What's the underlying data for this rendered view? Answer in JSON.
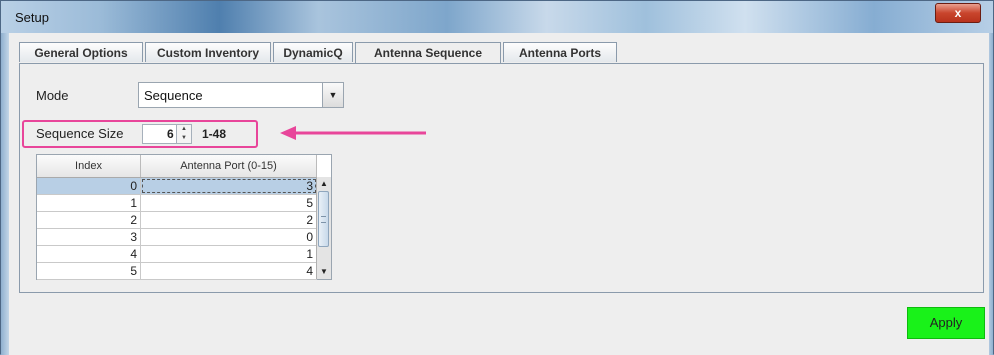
{
  "window": {
    "title": "Setup",
    "close_label": "x"
  },
  "tabs": [
    {
      "label": "General Options"
    },
    {
      "label": "Custom Inventory"
    },
    {
      "label": "DynamicQ"
    },
    {
      "label": "Antenna Sequence"
    },
    {
      "label": "Antenna Ports"
    }
  ],
  "active_tab": "Antenna Sequence",
  "mode": {
    "label": "Mode",
    "value": "Sequence"
  },
  "sequence_size": {
    "label": "Sequence Size",
    "value": "6",
    "range": "1-48"
  },
  "table": {
    "headers": [
      "Index",
      "Antenna Port (0-15)"
    ],
    "rows": [
      [
        "0",
        "3"
      ],
      [
        "1",
        "5"
      ],
      [
        "2",
        "2"
      ],
      [
        "3",
        "0"
      ],
      [
        "4",
        "1"
      ],
      [
        "5",
        "4"
      ]
    ]
  },
  "apply_label": "Apply",
  "colors": {
    "highlight": "#e8459a",
    "apply_bg": "#19f219",
    "selected_row": "#b8cfe5"
  }
}
